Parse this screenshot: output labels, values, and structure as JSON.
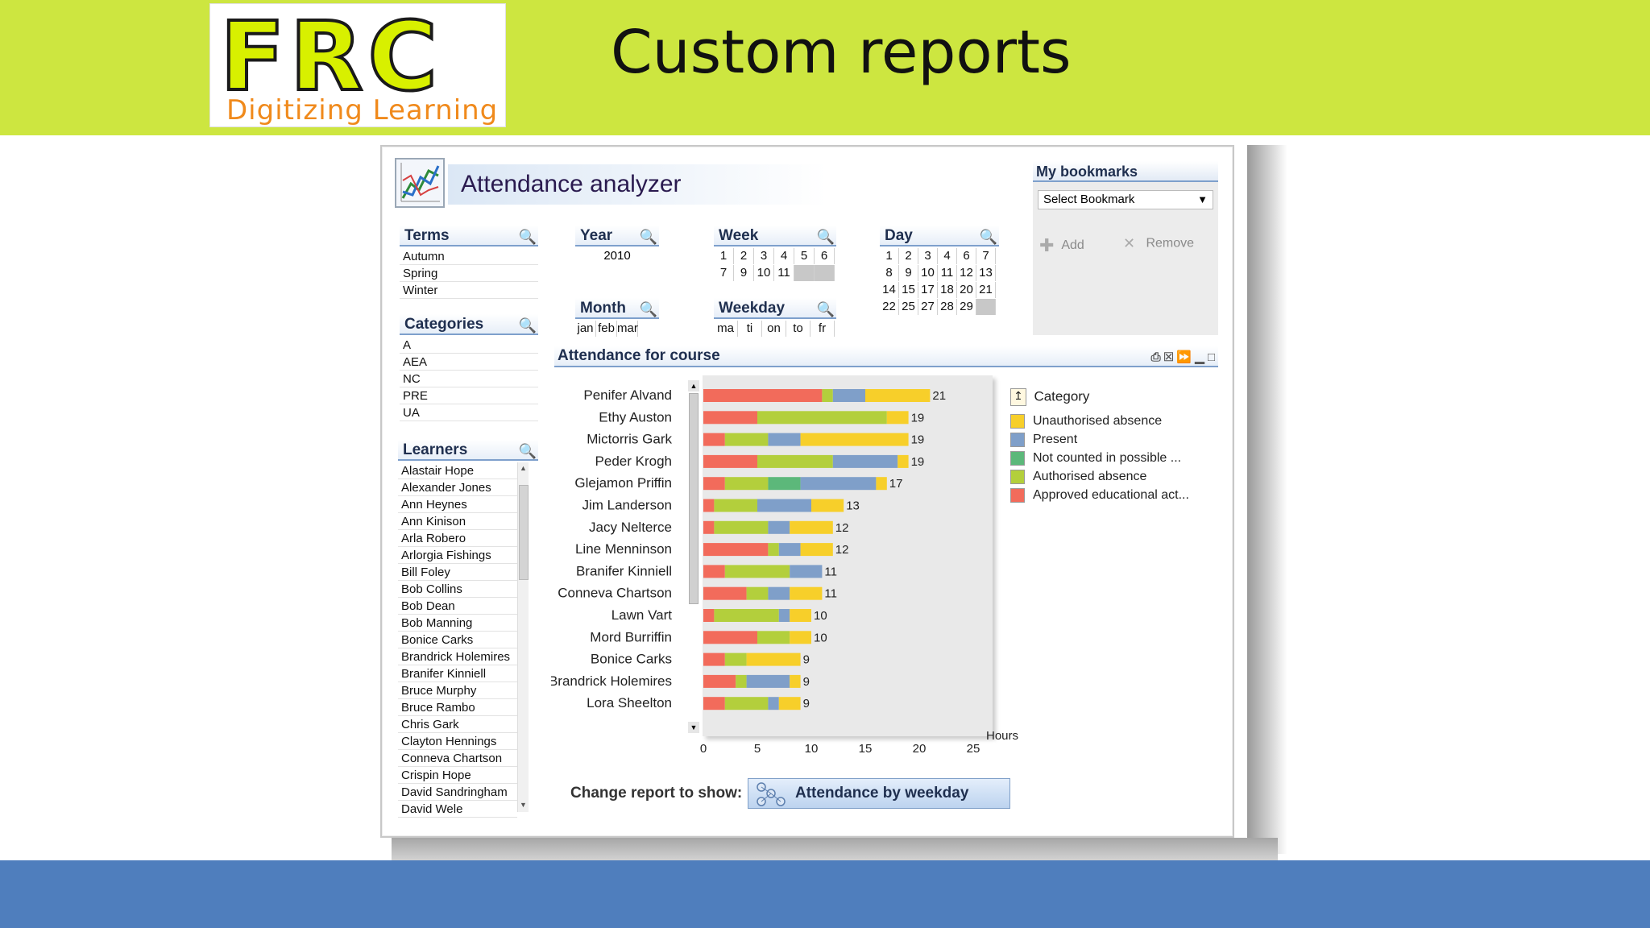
{
  "slide": {
    "title": "Custom reports",
    "logo_letters": "FRC",
    "logo_tagline": "Digitizing Learning",
    "colors": {
      "top_band": "#cde640",
      "bottom_band": "#4f7ebd"
    }
  },
  "app": {
    "title": "Attendance analyzer",
    "icon": "line-chart-icon"
  },
  "terms": {
    "title": "Terms",
    "items": [
      "Autumn",
      "Spring",
      "Winter"
    ]
  },
  "categories": {
    "title": "Categories",
    "items": [
      "A",
      "AEA",
      "NC",
      "PRE",
      "UA"
    ]
  },
  "learners": {
    "title": "Learners",
    "items": [
      "Alastair Hope",
      "Alexander Jones",
      "Ann Heynes",
      "Ann Kinison",
      "Arla Robero",
      "Arlorgia Fishings",
      "Bill Foley",
      "Bob Collins",
      "Bob Dean",
      "Bob Manning",
      "Bonice Carks",
      "Brandrick Holemires",
      "Branifer Kinniell",
      "Bruce Murphy",
      "Bruce Rambo",
      "Chris Gark",
      "Clayton Hennings",
      "Conneva Chartson",
      "Crispin Hope",
      "David Sandringham",
      "David Wele"
    ]
  },
  "year": {
    "title": "Year",
    "items": [
      "2010"
    ]
  },
  "month": {
    "title": "Month",
    "items": [
      "jan",
      "feb",
      "mar"
    ]
  },
  "week": {
    "title": "Week",
    "rows": [
      [
        "1",
        "2",
        "3",
        "4",
        "5",
        "6"
      ],
      [
        "7",
        "9",
        "10",
        "11",
        "",
        ""
      ]
    ]
  },
  "weekday": {
    "title": "Weekday",
    "items": [
      "ma",
      "ti",
      "on",
      "to",
      "fr"
    ]
  },
  "day": {
    "title": "Day",
    "rows": [
      [
        "1",
        "2",
        "3",
        "4",
        "6",
        "7"
      ],
      [
        "8",
        "9",
        "10",
        "11",
        "12",
        "13"
      ],
      [
        "14",
        "15",
        "17",
        "18",
        "20",
        "21"
      ],
      [
        "22",
        "25",
        "27",
        "28",
        "29",
        ""
      ]
    ]
  },
  "bookmarks": {
    "title": "My bookmarks",
    "select_value": "Select Bookmark",
    "add_label": "Add",
    "remove_label": "Remove"
  },
  "chart_data": {
    "type": "bar",
    "title": "Attendance for course",
    "orientation": "horizontal",
    "stacked": true,
    "xlabel": "Hours",
    "xlim": [
      0,
      25
    ],
    "xticks": [
      0,
      5,
      10,
      15,
      20,
      25
    ],
    "categories": [
      "Penifer Alvand",
      "Ethy Auston",
      "Mictorris Gark",
      "Peder Krogh",
      "Glejamon Priffin",
      "Jim Landerson",
      "Jacy Nelterce",
      "Line Menninson",
      "Branifer Kinniell",
      "Conneva Chartson",
      "Lawn Vart",
      "Mord Burriffin",
      "Bonice Carks",
      "Brandrick Holemires",
      "Lora Sheelton"
    ],
    "totals": [
      21,
      19,
      19,
      19,
      17,
      13,
      12,
      12,
      11,
      11,
      10,
      10,
      9,
      9,
      9
    ],
    "series": [
      {
        "name": "Approved educational act...",
        "color": "#f26b5b",
        "values": [
          11,
          5,
          2,
          5,
          2,
          1,
          1,
          6,
          2,
          4,
          1,
          5,
          2,
          3,
          2
        ]
      },
      {
        "name": "Authorised absence",
        "color": "#b3cf3c",
        "values": [
          1,
          12,
          4,
          7,
          4,
          4,
          5,
          1,
          6,
          2,
          6,
          3,
          2,
          1,
          4
        ]
      },
      {
        "name": "Not counted in possible ...",
        "color": "#5cb87a",
        "values": [
          0,
          0,
          0,
          0,
          3,
          0,
          0,
          0,
          0,
          0,
          0,
          0,
          0,
          0,
          0
        ]
      },
      {
        "name": "Present",
        "color": "#7f9fc9",
        "values": [
          3,
          0,
          3,
          6,
          7,
          5,
          2,
          2,
          3,
          2,
          1,
          0,
          0,
          4,
          1
        ]
      },
      {
        "name": "Unauthorised absence",
        "color": "#f7cf2a",
        "values": [
          6,
          2,
          10,
          1,
          1,
          3,
          4,
          3,
          0,
          3,
          2,
          2,
          5,
          1,
          2
        ]
      }
    ],
    "legend": {
      "title": "Category",
      "position": "right",
      "order": [
        "Unauthorised absence",
        "Present",
        "Not counted in possible ...",
        "Authorised absence",
        "Approved educational act..."
      ]
    },
    "data_labels": true,
    "grid": false
  },
  "change_report": {
    "label": "Change report to show:",
    "button": "Attendance by weekday"
  }
}
